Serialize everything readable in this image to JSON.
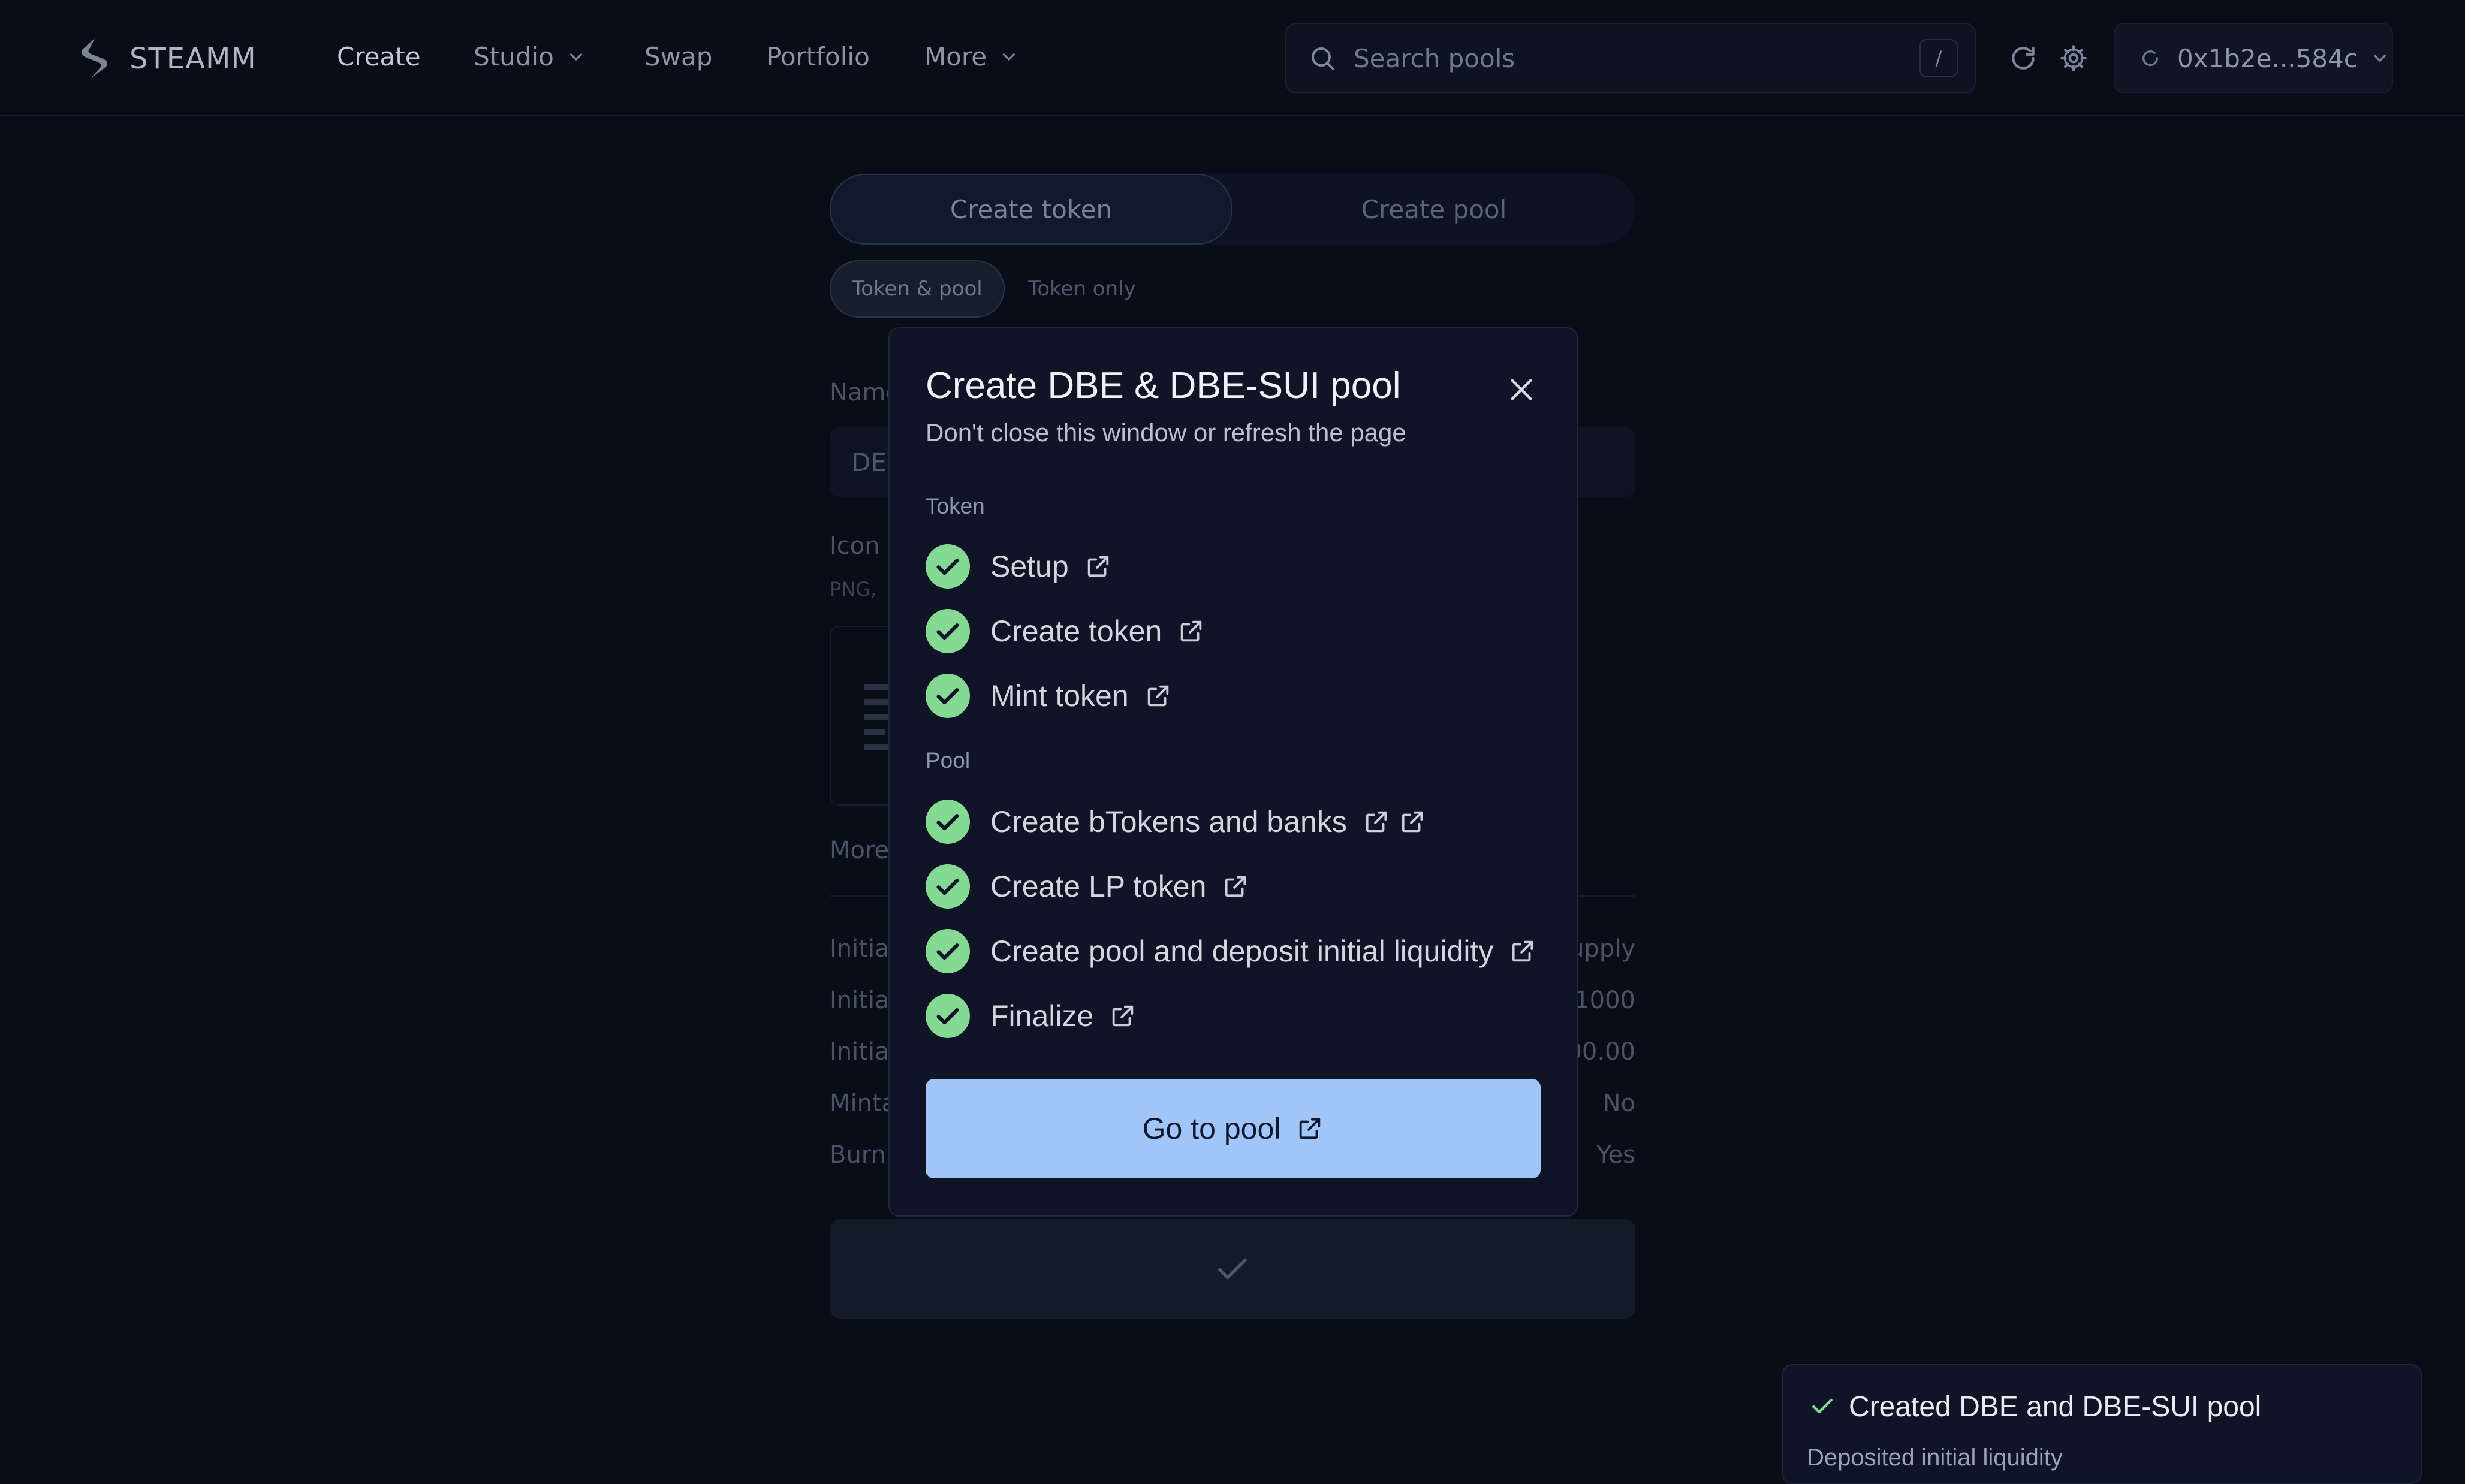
{
  "app": {
    "brand": "STEAMM"
  },
  "nav": {
    "items": [
      {
        "label": "Create"
      },
      {
        "label": "Studio"
      },
      {
        "label": "Swap"
      },
      {
        "label": "Portfolio"
      },
      {
        "label": "More"
      }
    ]
  },
  "search": {
    "placeholder": "Search pools",
    "shortcut": "/"
  },
  "wallet": {
    "address": "0x1b2e...584c"
  },
  "create": {
    "tabs": [
      "Create token",
      "Create pool"
    ],
    "subtabs": [
      "Token & pool",
      "Token only"
    ],
    "name_label": "Name",
    "name_value": "DE",
    "icon_label": "Icon",
    "icon_hint": "PNG,",
    "more_label": "More",
    "summary": [
      {
        "key": "Initial",
        "value": "upply"
      },
      {
        "key": "Initial",
        "value": "1000"
      },
      {
        "key": "Initial",
        "value": "00.00"
      },
      {
        "key": "Minta",
        "value": "No"
      },
      {
        "key": "Burn",
        "value": "Yes"
      }
    ]
  },
  "modal": {
    "title": "Create DBE & DBE-SUI pool",
    "subtitle": "Don't close this window or refresh the page",
    "token_section": "Token",
    "token_steps": [
      {
        "label": "Setup"
      },
      {
        "label": "Create token"
      },
      {
        "label": "Mint token"
      }
    ],
    "pool_section": "Pool",
    "pool_steps": [
      {
        "label": "Create bTokens and banks"
      },
      {
        "label": "Create LP token"
      },
      {
        "label": "Create pool and deposit initial liquidity"
      },
      {
        "label": "Finalize"
      }
    ],
    "primary_button": "Go to pool"
  },
  "toast": {
    "title": "Created DBE and DBE-SUI pool",
    "description": "Deposited initial liquidity"
  },
  "colors": {
    "background": "#080d18",
    "modal_bg": "#0f1526",
    "success_green": "#86d992",
    "primary_button": "#a0c5f6"
  },
  "icons": [
    "steamm-logo-icon",
    "chevron-down-icon",
    "search-icon",
    "refresh-icon",
    "gear-icon",
    "wallet-status-icon",
    "close-icon",
    "check-circle-icon",
    "external-link-icon",
    "check-icon"
  ]
}
